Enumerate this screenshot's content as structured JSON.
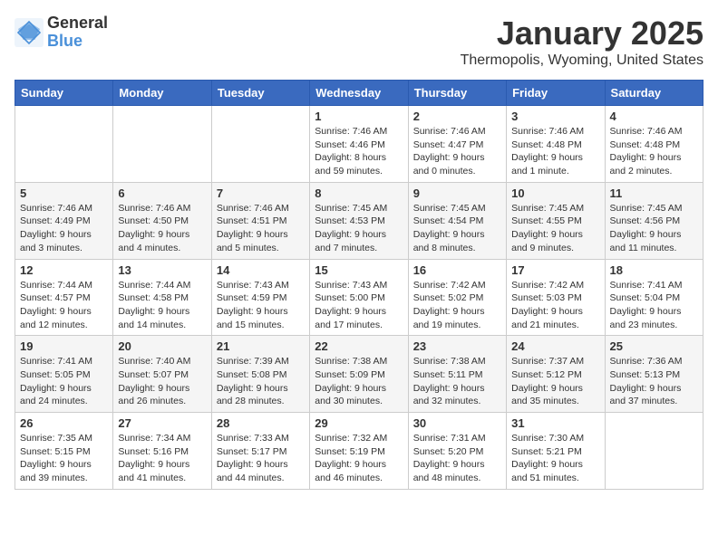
{
  "header": {
    "logo": {
      "general": "General",
      "blue": "Blue"
    },
    "title": "January 2025",
    "location": "Thermopolis, Wyoming, United States"
  },
  "calendar": {
    "weekdays": [
      "Sunday",
      "Monday",
      "Tuesday",
      "Wednesday",
      "Thursday",
      "Friday",
      "Saturday"
    ],
    "weeks": [
      [
        {
          "day": "",
          "info": ""
        },
        {
          "day": "",
          "info": ""
        },
        {
          "day": "",
          "info": ""
        },
        {
          "day": "1",
          "info": "Sunrise: 7:46 AM\nSunset: 4:46 PM\nDaylight: 8 hours and 59 minutes."
        },
        {
          "day": "2",
          "info": "Sunrise: 7:46 AM\nSunset: 4:47 PM\nDaylight: 9 hours and 0 minutes."
        },
        {
          "day": "3",
          "info": "Sunrise: 7:46 AM\nSunset: 4:48 PM\nDaylight: 9 hours and 1 minute."
        },
        {
          "day": "4",
          "info": "Sunrise: 7:46 AM\nSunset: 4:48 PM\nDaylight: 9 hours and 2 minutes."
        }
      ],
      [
        {
          "day": "5",
          "info": "Sunrise: 7:46 AM\nSunset: 4:49 PM\nDaylight: 9 hours and 3 minutes."
        },
        {
          "day": "6",
          "info": "Sunrise: 7:46 AM\nSunset: 4:50 PM\nDaylight: 9 hours and 4 minutes."
        },
        {
          "day": "7",
          "info": "Sunrise: 7:46 AM\nSunset: 4:51 PM\nDaylight: 9 hours and 5 minutes."
        },
        {
          "day": "8",
          "info": "Sunrise: 7:45 AM\nSunset: 4:53 PM\nDaylight: 9 hours and 7 minutes."
        },
        {
          "day": "9",
          "info": "Sunrise: 7:45 AM\nSunset: 4:54 PM\nDaylight: 9 hours and 8 minutes."
        },
        {
          "day": "10",
          "info": "Sunrise: 7:45 AM\nSunset: 4:55 PM\nDaylight: 9 hours and 9 minutes."
        },
        {
          "day": "11",
          "info": "Sunrise: 7:45 AM\nSunset: 4:56 PM\nDaylight: 9 hours and 11 minutes."
        }
      ],
      [
        {
          "day": "12",
          "info": "Sunrise: 7:44 AM\nSunset: 4:57 PM\nDaylight: 9 hours and 12 minutes."
        },
        {
          "day": "13",
          "info": "Sunrise: 7:44 AM\nSunset: 4:58 PM\nDaylight: 9 hours and 14 minutes."
        },
        {
          "day": "14",
          "info": "Sunrise: 7:43 AM\nSunset: 4:59 PM\nDaylight: 9 hours and 15 minutes."
        },
        {
          "day": "15",
          "info": "Sunrise: 7:43 AM\nSunset: 5:00 PM\nDaylight: 9 hours and 17 minutes."
        },
        {
          "day": "16",
          "info": "Sunrise: 7:42 AM\nSunset: 5:02 PM\nDaylight: 9 hours and 19 minutes."
        },
        {
          "day": "17",
          "info": "Sunrise: 7:42 AM\nSunset: 5:03 PM\nDaylight: 9 hours and 21 minutes."
        },
        {
          "day": "18",
          "info": "Sunrise: 7:41 AM\nSunset: 5:04 PM\nDaylight: 9 hours and 23 minutes."
        }
      ],
      [
        {
          "day": "19",
          "info": "Sunrise: 7:41 AM\nSunset: 5:05 PM\nDaylight: 9 hours and 24 minutes."
        },
        {
          "day": "20",
          "info": "Sunrise: 7:40 AM\nSunset: 5:07 PM\nDaylight: 9 hours and 26 minutes."
        },
        {
          "day": "21",
          "info": "Sunrise: 7:39 AM\nSunset: 5:08 PM\nDaylight: 9 hours and 28 minutes."
        },
        {
          "day": "22",
          "info": "Sunrise: 7:38 AM\nSunset: 5:09 PM\nDaylight: 9 hours and 30 minutes."
        },
        {
          "day": "23",
          "info": "Sunrise: 7:38 AM\nSunset: 5:11 PM\nDaylight: 9 hours and 32 minutes."
        },
        {
          "day": "24",
          "info": "Sunrise: 7:37 AM\nSunset: 5:12 PM\nDaylight: 9 hours and 35 minutes."
        },
        {
          "day": "25",
          "info": "Sunrise: 7:36 AM\nSunset: 5:13 PM\nDaylight: 9 hours and 37 minutes."
        }
      ],
      [
        {
          "day": "26",
          "info": "Sunrise: 7:35 AM\nSunset: 5:15 PM\nDaylight: 9 hours and 39 minutes."
        },
        {
          "day": "27",
          "info": "Sunrise: 7:34 AM\nSunset: 5:16 PM\nDaylight: 9 hours and 41 minutes."
        },
        {
          "day": "28",
          "info": "Sunrise: 7:33 AM\nSunset: 5:17 PM\nDaylight: 9 hours and 44 minutes."
        },
        {
          "day": "29",
          "info": "Sunrise: 7:32 AM\nSunset: 5:19 PM\nDaylight: 9 hours and 46 minutes."
        },
        {
          "day": "30",
          "info": "Sunrise: 7:31 AM\nSunset: 5:20 PM\nDaylight: 9 hours and 48 minutes."
        },
        {
          "day": "31",
          "info": "Sunrise: 7:30 AM\nSunset: 5:21 PM\nDaylight: 9 hours and 51 minutes."
        },
        {
          "day": "",
          "info": ""
        }
      ]
    ]
  }
}
